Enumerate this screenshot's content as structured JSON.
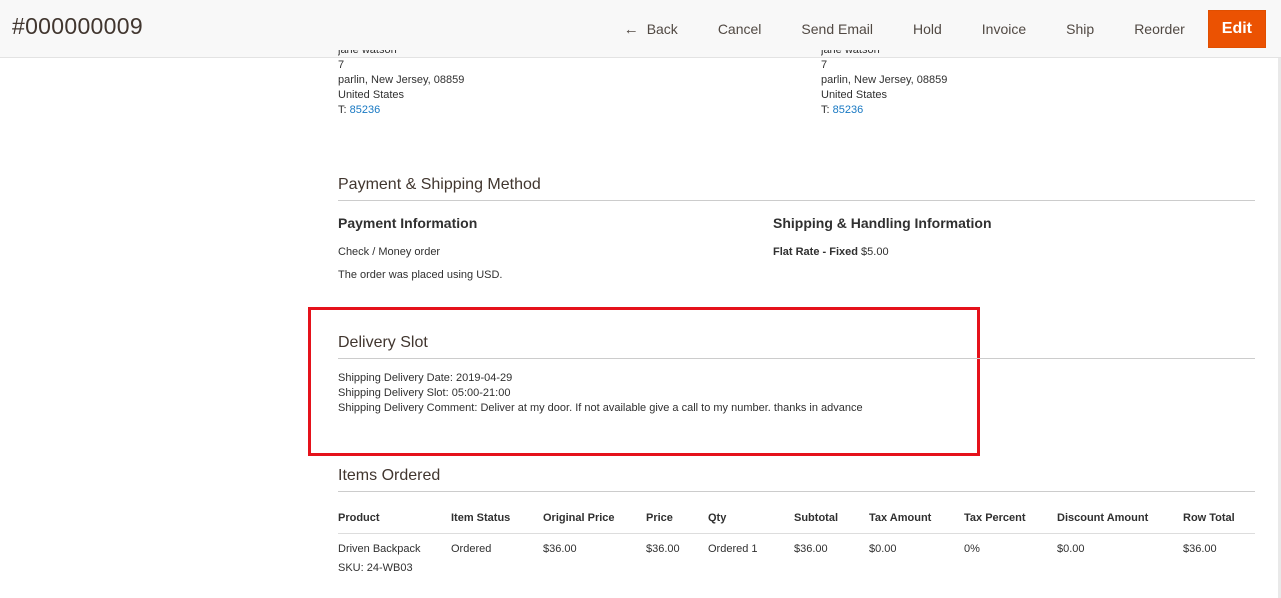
{
  "header": {
    "order_number": "#000000009",
    "actions": {
      "back": "Back",
      "cancel": "Cancel",
      "send_email": "Send Email",
      "hold": "Hold",
      "invoice": "Invoice",
      "ship": "Ship",
      "reorder": "Reorder",
      "edit": "Edit"
    },
    "accent_color": "#eb5202"
  },
  "billing_address": {
    "name": "jane watson",
    "street": "7",
    "city_line": "parlin, New Jersey, 08859",
    "country": "United States",
    "tel_prefix": "T: ",
    "tel": "85236"
  },
  "shipping_address": {
    "name": "jane watson",
    "street": "7",
    "city_line": "parlin, New Jersey, 08859",
    "country": "United States",
    "tel_prefix": "T: ",
    "tel": "85236"
  },
  "payment_shipping": {
    "section_title": "Payment & Shipping Method",
    "payment_title": "Payment Information",
    "payment_method": "Check / Money order",
    "payment_note": "The order was placed using USD.",
    "shipping_title": "Shipping & Handling Information",
    "shipping_method": "Flat Rate - Fixed",
    "shipping_price": "$5.00"
  },
  "delivery_slot": {
    "section_title": "Delivery Slot",
    "date": "Shipping Delivery Date: 2019-04-29",
    "slot": "Shipping Delivery Slot: 05:00-21:00",
    "comment": "Shipping Delivery Comment: Deliver at my door. If not available give a call to my number. thanks in advance",
    "highlight_color": "#e5121b"
  },
  "items_ordered": {
    "section_title": "Items Ordered",
    "columns": [
      "Product",
      "Item Status",
      "Original Price",
      "Price",
      "Qty",
      "Subtotal",
      "Tax Amount",
      "Tax Percent",
      "Discount Amount",
      "Row Total"
    ],
    "rows": [
      {
        "product": "Driven Backpack",
        "sku": "SKU: 24-WB03",
        "item_status": "Ordered",
        "original_price": "$36.00",
        "price": "$36.00",
        "qty": "Ordered 1",
        "subtotal": "$36.00",
        "tax_amount": "$0.00",
        "tax_percent": "0%",
        "discount_amount": "$0.00",
        "row_total": "$36.00"
      }
    ]
  }
}
